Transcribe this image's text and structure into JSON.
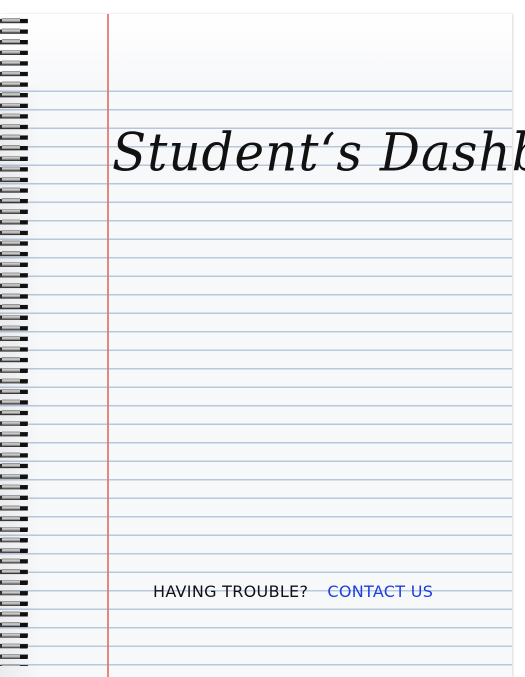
{
  "page": {
    "title": "Student‘s Dashboard"
  },
  "footer": {
    "prompt": "HAVING TROUBLE?",
    "contact_label": "CONTACT US"
  },
  "colors": {
    "paper": "#f7f8fa",
    "ruled_line": "#b8c7dc",
    "margin_line": "#e07a72",
    "text": "#111111",
    "link": "#1d3fe0"
  },
  "icons": {
    "binding": "spiral-binding-icon"
  }
}
